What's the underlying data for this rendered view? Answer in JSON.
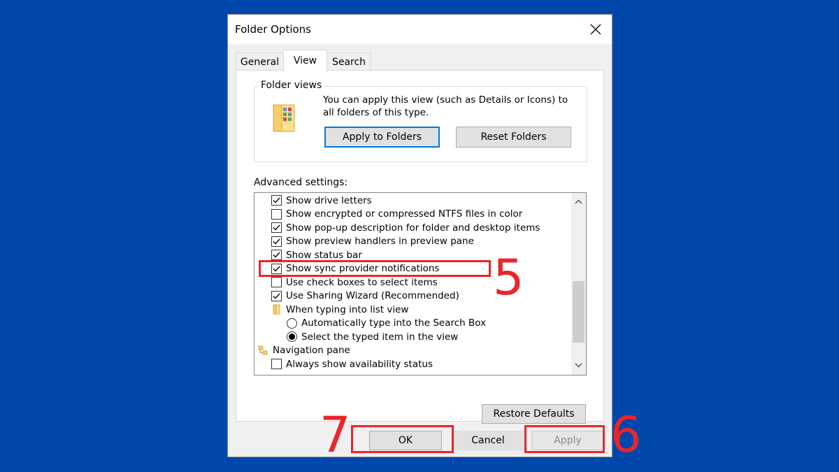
{
  "window": {
    "title": "Folder Options"
  },
  "tabs": [
    {
      "label": "General",
      "active": false
    },
    {
      "label": "View",
      "active": true
    },
    {
      "label": "Search",
      "active": false
    }
  ],
  "folder_views": {
    "group_label": "Folder views",
    "description": "You can apply this view (such as Details or Icons) to all folders of this type.",
    "apply_button": "Apply to Folders",
    "reset_button": "Reset Folders"
  },
  "advanced": {
    "label": "Advanced settings:",
    "items": [
      {
        "type": "checkbox",
        "label": "Show drive letters",
        "checked": true,
        "level": 1
      },
      {
        "type": "checkbox",
        "label": "Show encrypted or compressed NTFS files in color",
        "checked": false,
        "level": 1
      },
      {
        "type": "checkbox",
        "label": "Show pop-up description for folder and desktop items",
        "checked": true,
        "level": 1
      },
      {
        "type": "checkbox",
        "label": "Show preview handlers in preview pane",
        "checked": true,
        "level": 1
      },
      {
        "type": "checkbox",
        "label": "Show status bar",
        "checked": true,
        "level": 1
      },
      {
        "type": "checkbox",
        "label": "Show sync provider notifications",
        "checked": true,
        "level": 1
      },
      {
        "type": "checkbox",
        "label": "Use check boxes to select items",
        "checked": false,
        "level": 1
      },
      {
        "type": "checkbox",
        "label": "Use Sharing Wizard (Recommended)",
        "checked": true,
        "level": 1
      },
      {
        "type": "folder",
        "label": "When typing into list view",
        "level": 1
      },
      {
        "type": "radio",
        "label": "Automatically type into the Search Box",
        "checked": false,
        "level": 2
      },
      {
        "type": "radio",
        "label": "Select the typed item in the view",
        "checked": true,
        "level": 2
      },
      {
        "type": "category",
        "label": "Navigation pane",
        "level": 0
      },
      {
        "type": "checkbox",
        "label": "Always show availability status",
        "checked": false,
        "level": 1
      }
    ],
    "restore_button": "Restore Defaults"
  },
  "footer": {
    "ok_button": "OK",
    "cancel_button": "Cancel",
    "apply_button": "Apply",
    "apply_disabled": true
  },
  "annotations": [
    {
      "number": "5",
      "target": "Show sync provider notifications"
    },
    {
      "number": "6",
      "target": "Apply"
    },
    {
      "number": "7",
      "target": "OK"
    }
  ],
  "colors": {
    "desktop_background": "#0047ab",
    "annotation_red": "#e8262b",
    "focus_border": "#0078d7"
  },
  "icons": {
    "close": "close-icon",
    "folder_views": "folder-views-icon",
    "folder": "folder-icon",
    "navigation_pane": "navigation-pane-icon",
    "scroll_up": "chevron-up-icon",
    "scroll_down": "chevron-down-icon"
  }
}
